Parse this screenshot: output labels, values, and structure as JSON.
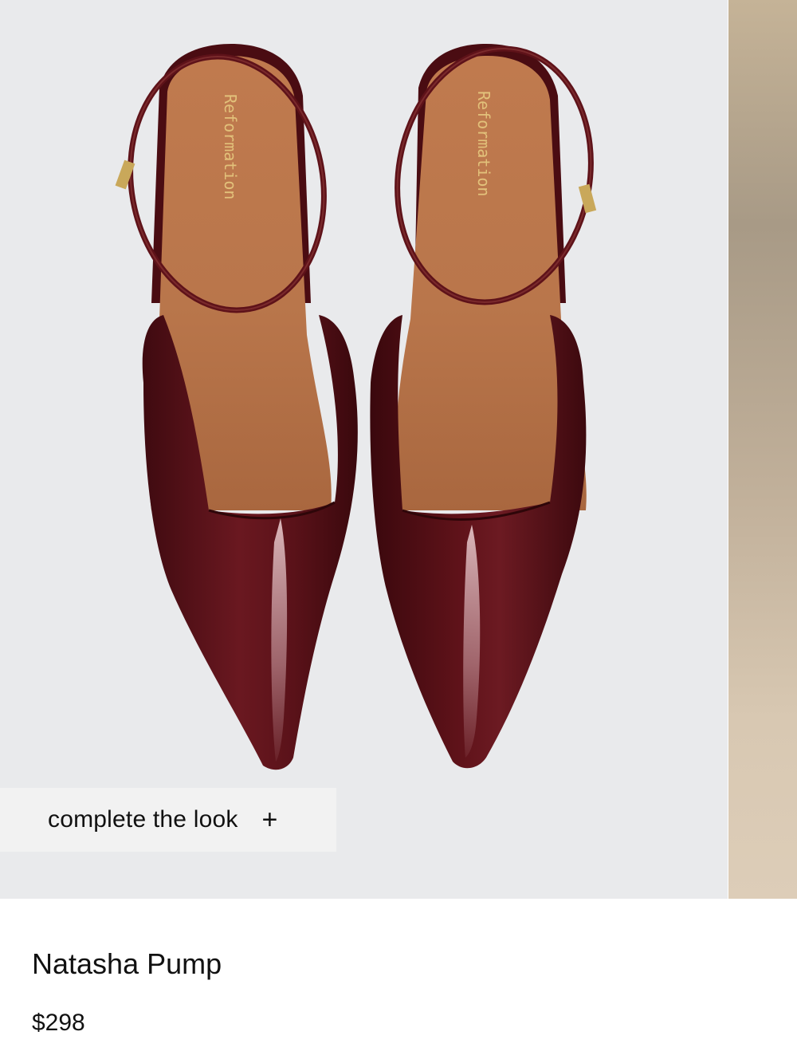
{
  "product": {
    "brand_imprint": "Reformation",
    "name": "Natasha Pump",
    "price": "$298"
  },
  "complete_the_look": {
    "label": "complete the look",
    "icon": "plus-icon",
    "glyph": "+"
  },
  "colors": {
    "photo_background": "#e9eaec",
    "patent_burgundy": "#5e1219",
    "insole_tan": "#b8734a",
    "buckle_gold": "#c9a85a"
  }
}
